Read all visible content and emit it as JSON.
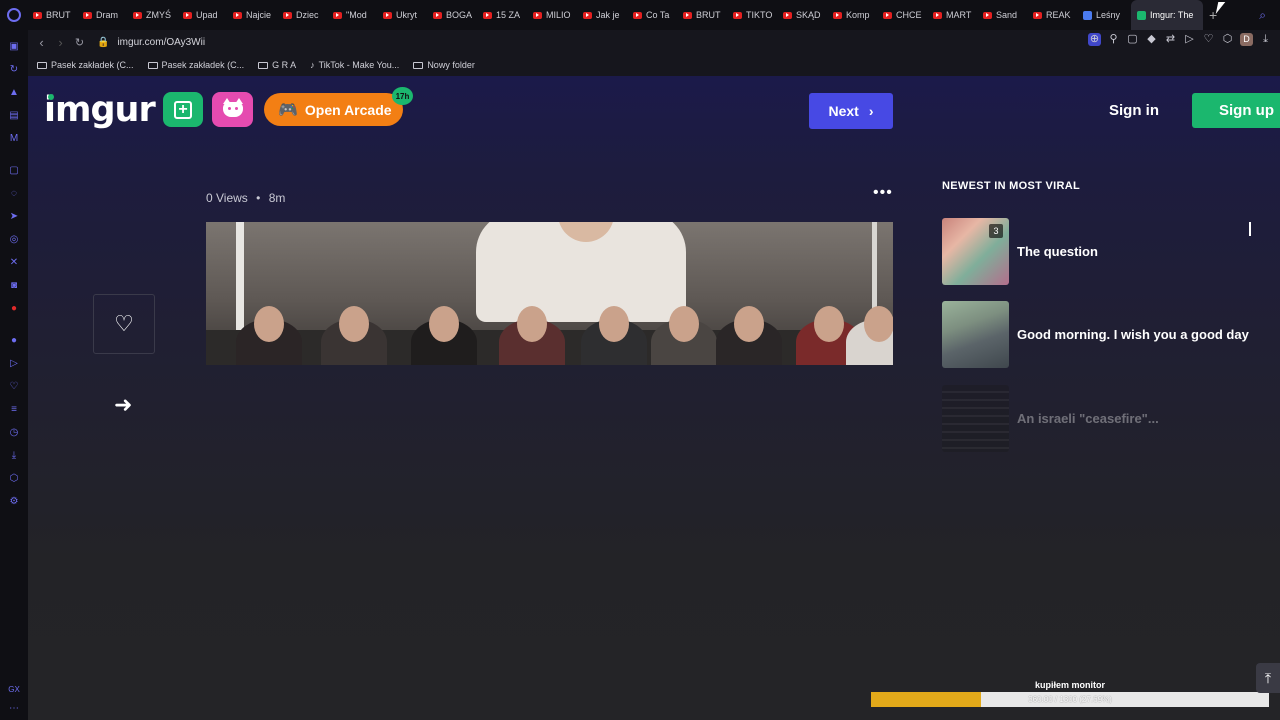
{
  "browser": {
    "tabs": [
      {
        "label": "BRUT",
        "favicon": "youtube-icon"
      },
      {
        "label": "Dram",
        "favicon": "youtube-icon"
      },
      {
        "label": "ZMYŚ",
        "favicon": "youtube-icon"
      },
      {
        "label": "Upad",
        "favicon": "youtube-icon"
      },
      {
        "label": "Najcie",
        "favicon": "youtube-icon"
      },
      {
        "label": "Dziec",
        "favicon": "youtube-icon"
      },
      {
        "label": "\"Mod",
        "favicon": "youtube-icon"
      },
      {
        "label": "Ukryt",
        "favicon": "youtube-icon"
      },
      {
        "label": "BOGA",
        "favicon": "youtube-icon"
      },
      {
        "label": "15 ZA",
        "favicon": "youtube-icon"
      },
      {
        "label": "MILIO",
        "favicon": "youtube-icon"
      },
      {
        "label": "Jak je",
        "favicon": "youtube-icon"
      },
      {
        "label": "Co Ta",
        "favicon": "youtube-icon"
      },
      {
        "label": "BRUT",
        "favicon": "youtube-icon"
      },
      {
        "label": "TIKTO",
        "favicon": "youtube-icon"
      },
      {
        "label": "SKĄD",
        "favicon": "youtube-icon"
      },
      {
        "label": "Komp",
        "favicon": "youtube-icon"
      },
      {
        "label": "CHCE",
        "favicon": "youtube-icon"
      },
      {
        "label": "MART",
        "favicon": "youtube-icon"
      },
      {
        "label": "Sand",
        "favicon": "youtube-icon"
      },
      {
        "label": "REAK",
        "favicon": "youtube-icon"
      },
      {
        "label": "Leśny",
        "favicon": "doc-icon"
      }
    ],
    "active_tab": {
      "label": "Imgur: The",
      "favicon": "imgur-icon"
    },
    "new_tab": "+",
    "url": "imgur.com/OAy3Wii",
    "bookmarks": [
      {
        "label": "Pasek zakładek (C...",
        "icon": "folder-icon"
      },
      {
        "label": "Pasek zakładek (C...",
        "icon": "folder-icon"
      },
      {
        "label": "G R A",
        "icon": "folder-icon"
      },
      {
        "label": "TikTok - Make You...",
        "icon": "tiktok-icon"
      },
      {
        "label": "Nowy folder",
        "icon": "folder-icon"
      }
    ],
    "avatar_letter": "D",
    "sidebar_bottom_label": "GX"
  },
  "imgur": {
    "logo": "imgur",
    "arcade_label": "Open Arcade",
    "arcade_badge": "17h",
    "next_label": "Next",
    "signin_label": "Sign in",
    "signup_label": "Sign up",
    "post": {
      "views": "0 Views",
      "separator": "•",
      "age": "8m",
      "more": "•••"
    },
    "viral": {
      "heading": "NEWEST IN MOST VIRAL",
      "items": [
        {
          "title": "The question",
          "count": "3"
        },
        {
          "title": "Good morning. I wish you a good day",
          "count": ""
        },
        {
          "title": "An israeli \"ceasefire\"...",
          "count": ""
        }
      ]
    }
  },
  "overlay": {
    "label": "kupiłem monitor",
    "progress_text": "360.00 / 1300 (27.69%)",
    "progress_fraction": 0.2769
  },
  "colors": {
    "accent_green": "#1bb76e",
    "accent_blue": "#4749e4",
    "arcade_orange": "#f37f14",
    "meme_pink": "#e54bb0",
    "progress_gold": "#e2a91a"
  }
}
